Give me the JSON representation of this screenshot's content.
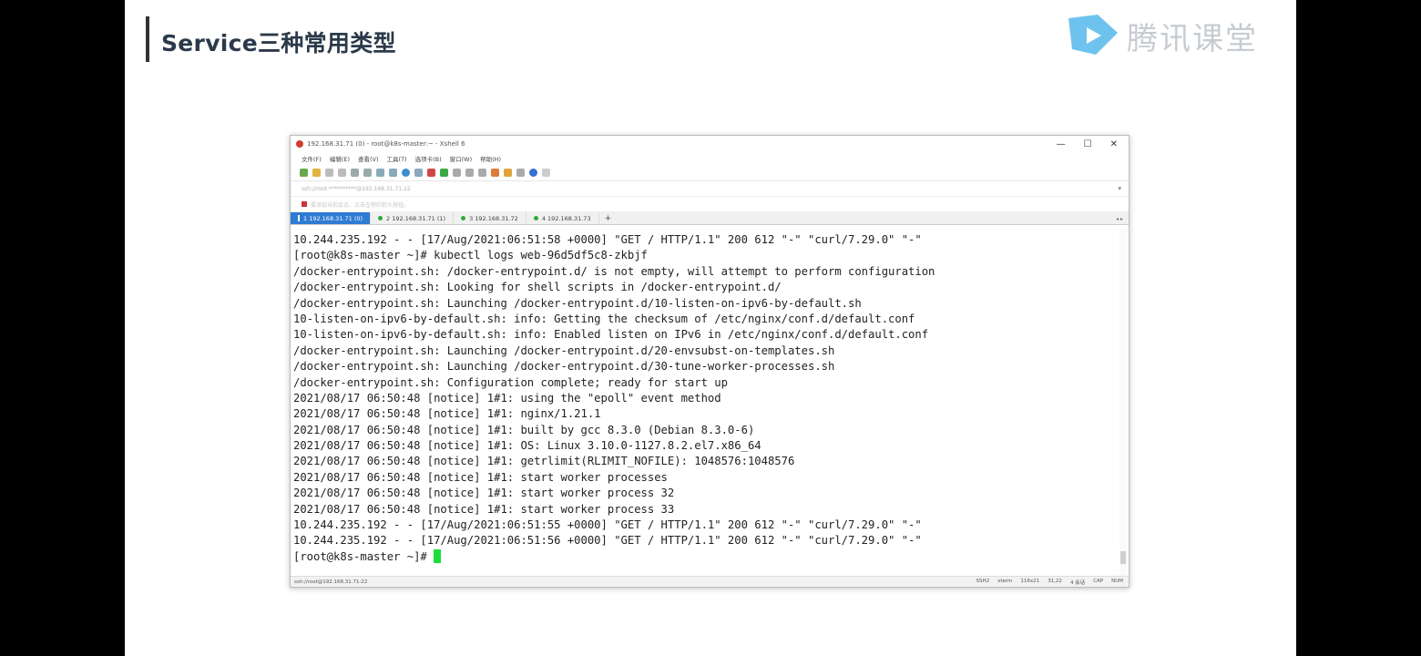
{
  "slide": {
    "title": "Service三种常用类型",
    "brand": "腾讯课堂"
  },
  "window": {
    "title": "192.168.31.71 (0) - root@k8s-master:~ - Xshell 6",
    "controls": [
      "—",
      "☐",
      "✕"
    ],
    "menu": [
      "文件(F)",
      "编辑(E)",
      "查看(V)",
      "工具(T)",
      "选项卡(B)",
      "窗口(W)",
      "帮助(H)"
    ],
    "address": "ssh://root:**********@192.168.31.71:22",
    "favorites": "要添加当前会话，点击左侧的箭头按钮。",
    "tabs": [
      {
        "label": "1 192.168.31.71 (0)"
      },
      {
        "label": "2 192.168.31.71 (1)"
      },
      {
        "label": "3 192.168.31.72"
      },
      {
        "label": "4 192.168.31.73"
      }
    ],
    "tab_add": "+",
    "status": {
      "left": "ssh://root@192.168.31.71:22",
      "items": [
        "SSH2",
        "xterm",
        "116x21",
        "31,22",
        "4 会话",
        "CAP",
        "NUM"
      ]
    }
  },
  "terminal": {
    "lines": [
      "10.244.235.192 - - [17/Aug/2021:06:51:58 +0000] \"GET / HTTP/1.1\" 200 612 \"-\" \"curl/7.29.0\" \"-\"",
      "[root@k8s-master ~]# kubectl logs web-96d5df5c8-zkbjf",
      "/docker-entrypoint.sh: /docker-entrypoint.d/ is not empty, will attempt to perform configuration",
      "/docker-entrypoint.sh: Looking for shell scripts in /docker-entrypoint.d/",
      "/docker-entrypoint.sh: Launching /docker-entrypoint.d/10-listen-on-ipv6-by-default.sh",
      "10-listen-on-ipv6-by-default.sh: info: Getting the checksum of /etc/nginx/conf.d/default.conf",
      "10-listen-on-ipv6-by-default.sh: info: Enabled listen on IPv6 in /etc/nginx/conf.d/default.conf",
      "/docker-entrypoint.sh: Launching /docker-entrypoint.d/20-envsubst-on-templates.sh",
      "/docker-entrypoint.sh: Launching /docker-entrypoint.d/30-tune-worker-processes.sh",
      "/docker-entrypoint.sh: Configuration complete; ready for start up",
      "2021/08/17 06:50:48 [notice] 1#1: using the \"epoll\" event method",
      "2021/08/17 06:50:48 [notice] 1#1: nginx/1.21.1",
      "2021/08/17 06:50:48 [notice] 1#1: built by gcc 8.3.0 (Debian 8.3.0-6)",
      "2021/08/17 06:50:48 [notice] 1#1: OS: Linux 3.10.0-1127.8.2.el7.x86_64",
      "2021/08/17 06:50:48 [notice] 1#1: getrlimit(RLIMIT_NOFILE): 1048576:1048576",
      "2021/08/17 06:50:48 [notice] 1#1: start worker processes",
      "2021/08/17 06:50:48 [notice] 1#1: start worker process 32",
      "2021/08/17 06:50:48 [notice] 1#1: start worker process 33",
      "10.244.235.192 - - [17/Aug/2021:06:51:55 +0000] \"GET / HTTP/1.1\" 200 612 \"-\" \"curl/7.29.0\" \"-\"",
      "10.244.235.192 - - [17/Aug/2021:06:51:56 +0000] \"GET / HTTP/1.1\" 200 612 \"-\" \"curl/7.29.0\" \"-\""
    ],
    "prompt": "[root@k8s-master ~]# "
  },
  "colors": {
    "cursor": "#1adf3a",
    "active_tab": "#2f7bd3",
    "title": "#2b3a4a"
  }
}
